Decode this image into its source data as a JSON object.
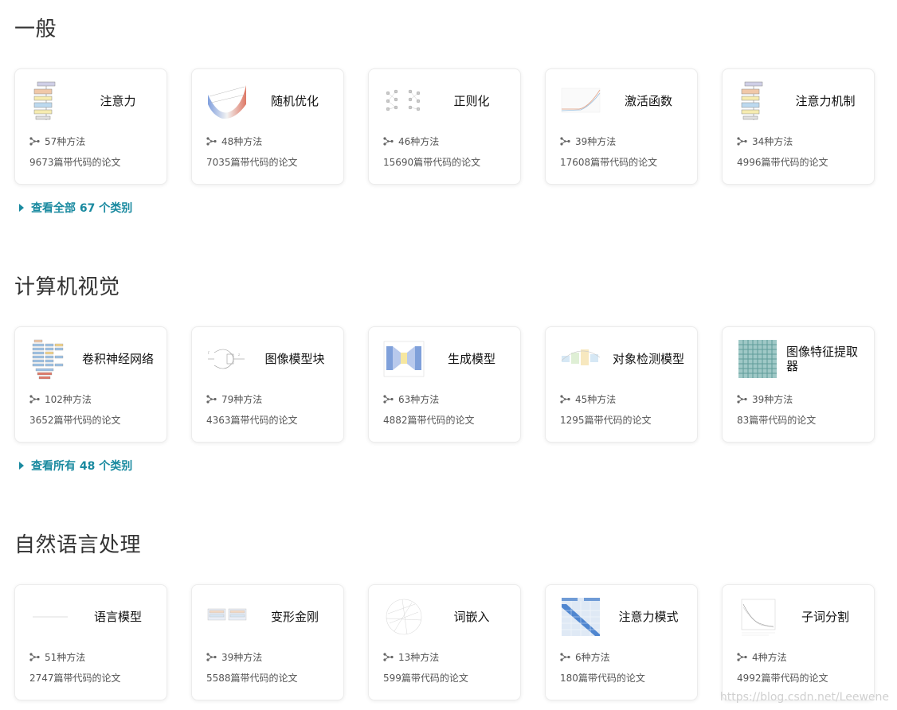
{
  "sections": [
    {
      "title": "一般",
      "see_all": "查看全部 67 个类别",
      "cards": [
        {
          "title": "注意力",
          "methods": "57种方法",
          "papers": "9673篇带代码的论文",
          "thumb": "transformer-diagram"
        },
        {
          "title": "随机优化",
          "methods": "48种方法",
          "papers": "7035篇带代码的论文",
          "thumb": "loss-surface"
        },
        {
          "title": "正则化",
          "methods": "46种方法",
          "papers": "15690篇带代码的论文",
          "thumb": "dropout-network"
        },
        {
          "title": "激活函数",
          "methods": "39种方法",
          "papers": "17608篇带代码的论文",
          "thumb": "activation-curve"
        },
        {
          "title": "注意力机制",
          "methods": "34种方法",
          "papers": "4996篇带代码的论文",
          "thumb": "transformer-diagram"
        }
      ]
    },
    {
      "title": "计算机视觉",
      "see_all": "查看所有 48 个类别",
      "cards": [
        {
          "title": "卷积神经网络",
          "methods": "102种方法",
          "papers": "3652篇带代码的论文",
          "thumb": "cnn-diagram"
        },
        {
          "title": "图像模型块",
          "methods": "79种方法",
          "papers": "4363篇带代码的论文",
          "thumb": "block-diagram"
        },
        {
          "title": "生成模型",
          "methods": "63种方法",
          "papers": "4882篇带代码的论文",
          "thumb": "generator-diagram"
        },
        {
          "title": "对象检测模型",
          "methods": "45种方法",
          "papers": "1295篇带代码的论文",
          "thumb": "detection-diagram"
        },
        {
          "title": "图像特征提取器",
          "methods": "39种方法",
          "papers": "83篇带代码的论文",
          "thumb": "feature-grid"
        }
      ]
    },
    {
      "title": "自然语言处理",
      "see_all": "",
      "cards": [
        {
          "title": "语言模型",
          "methods": "51种方法",
          "papers": "2747篇带代码的论文",
          "thumb": "faint-line"
        },
        {
          "title": "变形金刚",
          "methods": "39种方法",
          "papers": "5588篇带代码的论文",
          "thumb": "transformer-blocks"
        },
        {
          "title": "词嵌入",
          "methods": "13种方法",
          "papers": "599篇带代码的论文",
          "thumb": "embedding-circle"
        },
        {
          "title": "注意力模式",
          "methods": "6种方法",
          "papers": "180篇带代码的论文",
          "thumb": "attention-matrix"
        },
        {
          "title": "子词分割",
          "methods": "4种方法",
          "papers": "4992篇带代码的论文",
          "thumb": "plot-figure"
        }
      ]
    }
  ],
  "watermark": "https://blog.csdn.net/Leewene",
  "colors": {
    "link": "#1a8aa0",
    "card_border": "#ececec",
    "text_muted": "#555555"
  }
}
